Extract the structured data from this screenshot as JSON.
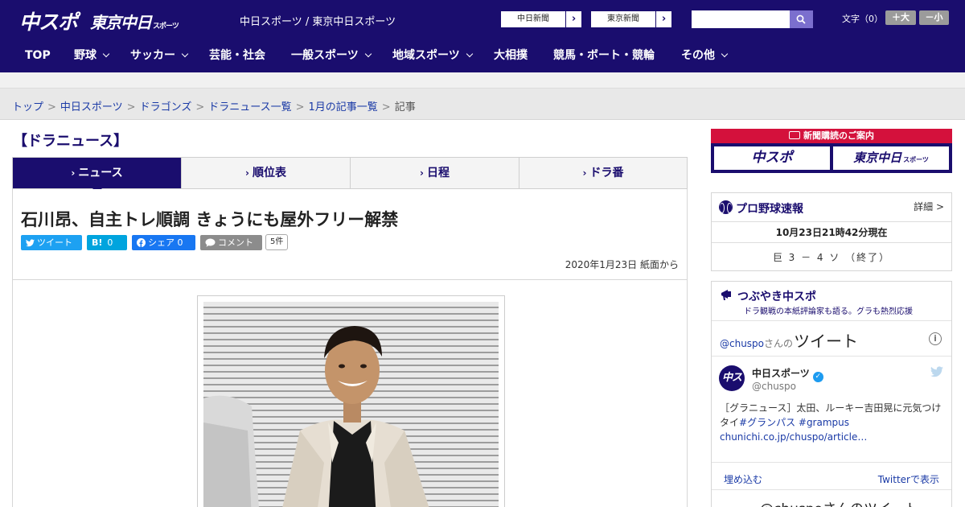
{
  "header": {
    "logo_main": "中スポ",
    "logo_tokyo": "東京中日",
    "logo_tokyo_small": "スポーツ",
    "site_title": "中日スポーツ / 東京中日スポーツ",
    "link_chunichi": "中日新聞",
    "link_tokyo": "東京新聞",
    "search": {
      "placeholder": ""
    },
    "font_size_label": "文字（0）",
    "font_plus": "＋大",
    "font_minus": "－小"
  },
  "nav": {
    "items": [
      {
        "label": "TOP",
        "dropdown": false
      },
      {
        "label": "野球",
        "dropdown": true
      },
      {
        "label": "サッカー",
        "dropdown": true
      },
      {
        "label": "芸能・社会",
        "dropdown": false
      },
      {
        "label": "一般スポーツ",
        "dropdown": true
      },
      {
        "label": "地域スポーツ",
        "dropdown": true
      },
      {
        "label": "大相撲",
        "dropdown": false
      },
      {
        "label": "競馬・ボート・競輪",
        "dropdown": false
      },
      {
        "label": "その他",
        "dropdown": true
      }
    ]
  },
  "breadcrumb": {
    "items": [
      "トップ",
      "中日スポーツ",
      "ドラゴンズ",
      "ドラニュース一覧",
      "1月の記事一覧"
    ],
    "current": "記事",
    "separator": ">"
  },
  "section_title": "【ドラニュース】",
  "tabs": [
    {
      "label": "ニュース",
      "active": true
    },
    {
      "label": "順位表",
      "active": false
    },
    {
      "label": "日程",
      "active": false
    },
    {
      "label": "ドラ番",
      "active": false
    }
  ],
  "article": {
    "headline": "石川昂、自主トレ順調 きょうにも屋外フリー解禁",
    "share": {
      "tweet": "ツイート",
      "hatena": "0",
      "facebook": "シェア 0",
      "comment": "コメント",
      "comment_count": "5件"
    },
    "dateline": "2020年1月23日 紙面から"
  },
  "sidebar": {
    "promo": {
      "title": "新聞購読のご案内",
      "box1": "中スポ",
      "box2": "東京中日",
      "box2_small": "スポーツ"
    },
    "scores": {
      "title": "プロ野球速報",
      "detail": "詳細 >",
      "time": "10月23日21時42分現在",
      "result": "巨 3 － 4 ソ （終了）"
    },
    "tweets": {
      "title": "つぶやき中スポ",
      "subtitle": "ドラ観戦の本紙評論家も語る。グラも熱烈応援",
      "handle_link": "@chuspo",
      "handle_suffix": "さんの",
      "heading": "ツイート",
      "account_name": "中日スポーツ",
      "account_handle": "@chuspo",
      "tweet_text": "［グラニュース］太田、ルーキー吉田晃に元気つけタイ",
      "tags": "#グランパス #grampus",
      "link": "chunichi.co.jp/chuspo/article…",
      "embed": "埋め込む",
      "view_on_twitter": "Twitterで表示",
      "next_heading": "@chuspoさんのツイート"
    }
  },
  "colors": {
    "brand_navy": "#1a0d6e",
    "promo_red": "#d4113c",
    "twitter_blue": "#1da1f2",
    "hatena_blue": "#00a4de",
    "facebook_blue": "#1877f2",
    "comment_gray": "#8c8c8c",
    "link_blue": "#1a3aa6"
  }
}
